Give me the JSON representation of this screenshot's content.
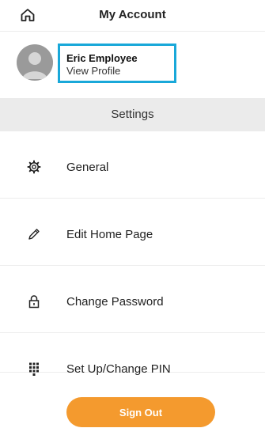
{
  "header": {
    "title": "My Account",
    "home_icon": "home-icon"
  },
  "profile": {
    "name": "Eric Employee",
    "link_label": "View Profile",
    "highlight_color": "#19a8d9"
  },
  "settings": {
    "title": "Settings"
  },
  "menu": {
    "items": [
      {
        "label": "General",
        "icon": "gear-icon"
      },
      {
        "label": "Edit Home Page",
        "icon": "pencil-icon"
      },
      {
        "label": "Change Password",
        "icon": "lock-icon"
      },
      {
        "label": "Set Up/Change PIN",
        "icon": "keypad-icon"
      }
    ]
  },
  "footer": {
    "signout_label": "Sign Out",
    "signout_color": "#f49a2e"
  }
}
